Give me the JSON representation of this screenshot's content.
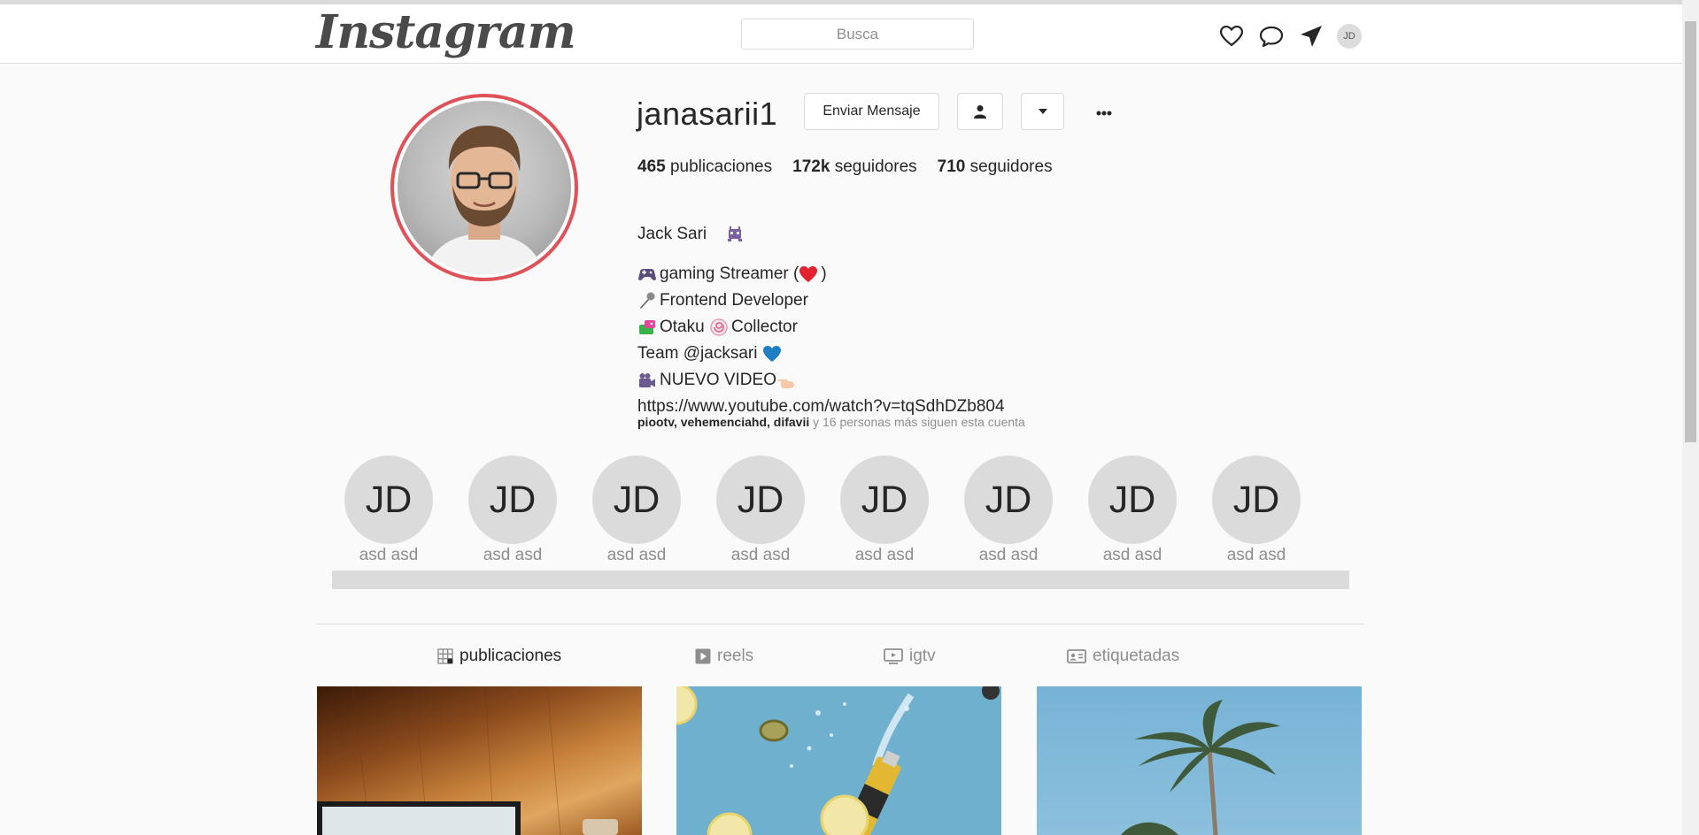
{
  "header": {
    "logo": "Instagram",
    "search_placeholder": "Busca",
    "avatar_initials": "JD"
  },
  "profile": {
    "username": "janasarii1",
    "buttons": {
      "message": "Enviar Mensaje"
    },
    "stats": [
      {
        "count": "465",
        "label": "publicaciones"
      },
      {
        "count": "172k",
        "label": "seguidores"
      },
      {
        "count": "710",
        "label": "seguidores"
      }
    ],
    "bio": [
      {
        "icon": "alien-monster-emoji",
        "text": "Jack Sari",
        "icon_after": true
      },
      {
        "icon": "game-controller-emoji",
        "text": "gaming Streamer (",
        "text_after": ")",
        "icon2": "red-heart-emoji"
      },
      {
        "icon": "microphone-emoji",
        "text": "Frontend Developer"
      },
      {
        "icon": "dragon-emoji",
        "text": "Otaku ",
        "icon2": "fish-cake-emoji",
        "text_after": "Collector"
      },
      {
        "icon": "blue-heart-emoji",
        "text": "Team @jacksari ",
        "icon_after": true
      },
      {
        "icon": "video-camera-emoji",
        "text": "NUEVO VIDEO",
        "icon2": "pointing-hand-emoji"
      },
      {
        "text": "https://www.youtube.com/watch?v=tqSdhDZb804",
        "link": true
      }
    ],
    "followed_by": {
      "names": "piootv, vehemenciahd, difavii",
      "rest": " y 16 personas más siguen esta cuenta"
    }
  },
  "highlights": [
    {
      "initials": "JD",
      "label": "asd asd"
    },
    {
      "initials": "JD",
      "label": "asd asd"
    },
    {
      "initials": "JD",
      "label": "asd asd"
    },
    {
      "initials": "JD",
      "label": "asd asd"
    },
    {
      "initials": "JD",
      "label": "asd asd"
    },
    {
      "initials": "JD",
      "label": "asd asd"
    },
    {
      "initials": "JD",
      "label": "asd asd"
    },
    {
      "initials": "JD",
      "label": "asd asd"
    }
  ],
  "tabs": [
    {
      "label": "publicaciones",
      "icon": "grid-icon",
      "active": true
    },
    {
      "label": "reels",
      "icon": "play-icon"
    },
    {
      "label": "igtv",
      "icon": "tv-icon"
    },
    {
      "label": "etiquetadas",
      "icon": "tag-icon"
    }
  ],
  "colors": {
    "story_ring": "#e0525a",
    "text": "#262626",
    "muted": "#8e8e8e",
    "background": "#fafafa"
  }
}
